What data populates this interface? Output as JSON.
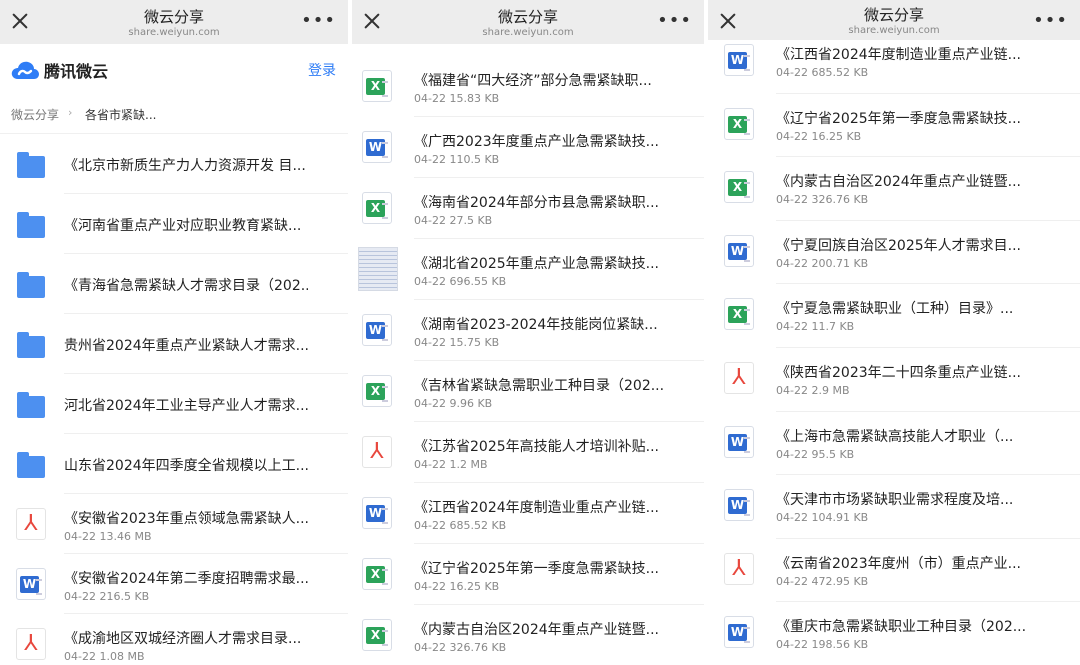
{
  "screens": [
    {
      "titlebar": {
        "title": "微云分享",
        "url": "share.weiyun.com"
      },
      "appbar": {
        "brand": "腾讯微云",
        "login": "登录"
      },
      "breadcrumb": {
        "root": "微云分享",
        "sep": "›",
        "current": "各省市紧缺..."
      },
      "files": [
        {
          "type": "folder",
          "icon": "folder-icon",
          "name": "《北京市新质生产力人力资源开发 目...",
          "meta": ""
        },
        {
          "type": "folder",
          "icon": "folder-icon",
          "name": "《河南省重点产业对应职业教育紧缺...",
          "meta": ""
        },
        {
          "type": "folder",
          "icon": "folder-icon",
          "name": "《青海省急需紧缺人才需求目录（202...",
          "meta": ""
        },
        {
          "type": "folder",
          "icon": "folder-icon",
          "name": "贵州省2024年重点产业紧缺人才需求...",
          "meta": ""
        },
        {
          "type": "folder",
          "icon": "folder-icon",
          "name": "河北省2024年工业主导产业人才需求...",
          "meta": ""
        },
        {
          "type": "folder",
          "icon": "folder-icon",
          "name": "山东省2024年四季度全省规模以上工...",
          "meta": ""
        },
        {
          "type": "pdf",
          "icon": "pdf-file-icon",
          "name": "《安徽省2023年重点领域急需紧缺人...",
          "meta": "04-22 13.46 MB"
        },
        {
          "type": "word",
          "icon": "word-file-icon",
          "name": "《安徽省2024年第二季度招聘需求最...",
          "meta": "04-22 216.5 KB"
        },
        {
          "type": "pdf",
          "icon": "pdf-file-icon",
          "name": "《成渝地区双城经济圈人才需求目录...",
          "meta": "04-22 1.08 MB"
        }
      ]
    },
    {
      "titlebar": {
        "title": "微云分享",
        "url": "share.weiyun.com"
      },
      "files": [
        {
          "type": "excel",
          "icon": "excel-file-icon",
          "name": "《福建省“四大经济”部分急需紧缺职...",
          "meta": "04-22 15.83 KB"
        },
        {
          "type": "word",
          "icon": "word-file-icon",
          "name": "《广西2023年度重点产业急需紧缺技...",
          "meta": "04-22 110.5 KB"
        },
        {
          "type": "excel",
          "icon": "excel-file-icon",
          "name": "《海南省2024年部分市县急需紧缺职...",
          "meta": "04-22 27.5 KB"
        },
        {
          "type": "image",
          "icon": "image-file-icon",
          "name": "《湖北省2025年重点产业急需紧缺技...",
          "meta": "04-22 696.55 KB"
        },
        {
          "type": "word",
          "icon": "word-file-icon",
          "name": "《湖南省2023-2024年技能岗位紧缺...",
          "meta": "04-22 15.75 KB"
        },
        {
          "type": "excel",
          "icon": "excel-file-icon",
          "name": "《吉林省紧缺急需职业工种目录（202...",
          "meta": "04-22 9.96 KB"
        },
        {
          "type": "pdf",
          "icon": "pdf-file-icon",
          "name": "《江苏省2025年高技能人才培训补贴...",
          "meta": "04-22 1.2 MB"
        },
        {
          "type": "word",
          "icon": "word-file-icon",
          "name": "《江西省2024年度制造业重点产业链...",
          "meta": "04-22 685.52 KB"
        },
        {
          "type": "excel",
          "icon": "excel-file-icon",
          "name": "《辽宁省2025年第一季度急需紧缺技...",
          "meta": "04-22 16.25 KB"
        },
        {
          "type": "excel",
          "icon": "excel-file-icon",
          "name": "《内蒙古自治区2024年重点产业链暨...",
          "meta": "04-22 326.76 KB"
        }
      ]
    },
    {
      "titlebar": {
        "title": "微云分享",
        "url": "share.weiyun.com"
      },
      "files": [
        {
          "type": "word",
          "icon": "word-file-icon",
          "name": "《江西省2024年度制造业重点产业链...",
          "meta": "04-22 685.52 KB"
        },
        {
          "type": "excel",
          "icon": "excel-file-icon",
          "name": "《辽宁省2025年第一季度急需紧缺技...",
          "meta": "04-22 16.25 KB"
        },
        {
          "type": "excel",
          "icon": "excel-file-icon",
          "name": "《内蒙古自治区2024年重点产业链暨...",
          "meta": "04-22 326.76 KB"
        },
        {
          "type": "word",
          "icon": "word-file-icon",
          "name": "《宁夏回族自治区2025年人才需求目...",
          "meta": "04-22 200.71 KB"
        },
        {
          "type": "excel",
          "icon": "excel-file-icon",
          "name": "《宁夏急需紧缺职业（工种）目录》...",
          "meta": "04-22 11.7 KB"
        },
        {
          "type": "pdf",
          "icon": "pdf-file-icon",
          "name": "《陕西省2023年二十四条重点产业链...",
          "meta": "04-22 2.9 MB"
        },
        {
          "type": "word",
          "icon": "word-file-icon",
          "name": "《上海市急需紧缺高技能人才职业（...",
          "meta": "04-22 95.5 KB"
        },
        {
          "type": "word",
          "icon": "word-file-icon",
          "name": "《天津市市场紧缺职业需求程度及培...",
          "meta": "04-22 104.91 KB"
        },
        {
          "type": "pdf",
          "icon": "pdf-file-icon",
          "name": "《云南省2023年度州（市）重点产业...",
          "meta": "04-22 472.95 KB"
        },
        {
          "type": "word",
          "icon": "word-file-icon",
          "name": "《重庆市急需紧缺职业工种目录（202...",
          "meta": "04-22 198.56 KB"
        }
      ]
    }
  ],
  "icon_glyphs": {
    "word": "W",
    "excel": "X",
    "pdf": "⅄"
  },
  "colors": {
    "accent": "#2f7df6",
    "folder": "#4d90f0",
    "word": "#2f6bd1",
    "excel": "#2ca35a",
    "pdf": "#e8473d"
  }
}
